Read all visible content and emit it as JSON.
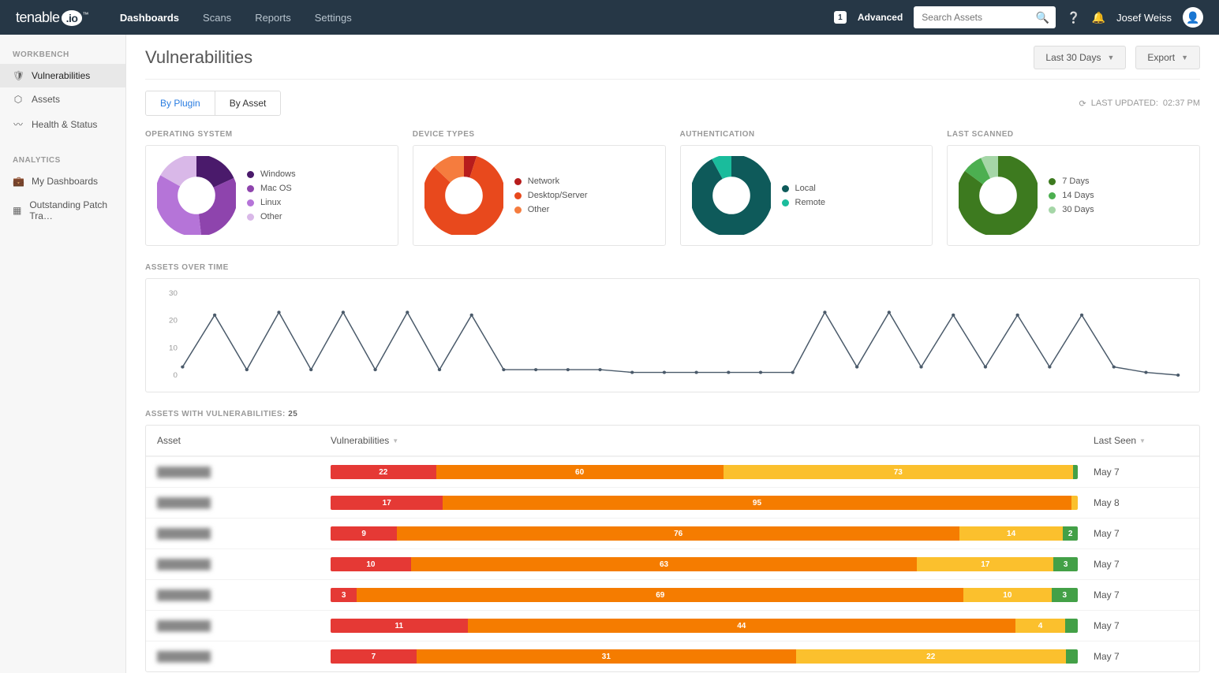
{
  "topbar": {
    "logo": "tenable",
    "logo_suffix": ".io",
    "nav": [
      "Dashboards",
      "Scans",
      "Reports",
      "Settings"
    ],
    "nav_active_index": 0,
    "advanced_badge": "1",
    "advanced_label": "Advanced",
    "search_placeholder": "Search Assets",
    "user_name": "Josef Weiss"
  },
  "sidebar": {
    "workbench_label": "WORKBENCH",
    "workbench_items": [
      {
        "icon": "shield",
        "label": "Vulnerabilities",
        "active": true
      },
      {
        "icon": "cube",
        "label": "Assets"
      },
      {
        "icon": "pulse",
        "label": "Health & Status"
      }
    ],
    "analytics_label": "ANALYTICS",
    "analytics_items": [
      {
        "icon": "briefcase",
        "label": "My Dashboards"
      },
      {
        "icon": "grid",
        "label": "Outstanding Patch Tra…"
      }
    ]
  },
  "page": {
    "title": "Vulnerabilities",
    "date_filter": "Last 30 Days",
    "export_label": "Export",
    "tabs": [
      "By Plugin",
      "By Asset"
    ],
    "tab_active_index": 1,
    "last_updated_label": "LAST UPDATED:",
    "last_updated_time": "02:37 PM"
  },
  "chart_data": [
    {
      "type": "pie",
      "title": "OPERATING SYSTEM",
      "series": [
        {
          "name": "Windows",
          "value": 18,
          "color": "#4a1a6b"
        },
        {
          "name": "Mac OS",
          "value": 30,
          "color": "#8e44ad"
        },
        {
          "name": "Linux",
          "value": 35,
          "color": "#b574d8"
        },
        {
          "name": "Other",
          "value": 17,
          "color": "#d9b8e8"
        }
      ]
    },
    {
      "type": "pie",
      "title": "DEVICE TYPES",
      "series": [
        {
          "name": "Network",
          "value": 5,
          "color": "#b71c1c"
        },
        {
          "name": "Desktop/Server",
          "value": 82,
          "color": "#e8491d"
        },
        {
          "name": "Other",
          "value": 13,
          "color": "#f57c3e"
        }
      ]
    },
    {
      "type": "pie",
      "title": "AUTHENTICATION",
      "series": [
        {
          "name": "Local",
          "value": 92,
          "color": "#0e5a5a"
        },
        {
          "name": "Remote",
          "value": 8,
          "color": "#1abc9c"
        }
      ]
    },
    {
      "type": "pie",
      "title": "LAST SCANNED",
      "series": [
        {
          "name": "7 Days",
          "value": 85,
          "color": "#3d7a1f"
        },
        {
          "name": "14 Days",
          "value": 8,
          "color": "#4caf50"
        },
        {
          "name": "30 Days",
          "value": 7,
          "color": "#a5d6a7"
        }
      ]
    },
    {
      "type": "line",
      "title": "ASSETS OVER TIME",
      "ylim": [
        0,
        30
      ],
      "yticks": [
        0,
        10,
        20,
        30
      ],
      "values": [
        3,
        22,
        2,
        23,
        2,
        23,
        2,
        23,
        2,
        22,
        2,
        2,
        2,
        2,
        1,
        1,
        1,
        1,
        1,
        1,
        23,
        3,
        23,
        3,
        22,
        3,
        22,
        3,
        22,
        3,
        1,
        0
      ]
    }
  ],
  "assets_table": {
    "title_prefix": "ASSETS WITH VULNERABILITIES:",
    "count": "25",
    "columns": {
      "asset": "Asset",
      "vuln": "Vulnerabilities",
      "last": "Last Seen"
    },
    "rows": [
      {
        "asset": "████████",
        "bars": [
          {
            "sev": "crit",
            "n": 22
          },
          {
            "sev": "high",
            "n": 60
          },
          {
            "sev": "med",
            "n": 73
          },
          {
            "sev": "low",
            "n": 1
          }
        ],
        "last": "May 7"
      },
      {
        "asset": "████████",
        "bars": [
          {
            "sev": "crit",
            "n": 17
          },
          {
            "sev": "high",
            "n": 95
          },
          {
            "sev": "med",
            "n": 1
          }
        ],
        "last": "May 8"
      },
      {
        "asset": "████████",
        "bars": [
          {
            "sev": "crit",
            "n": 9
          },
          {
            "sev": "high",
            "n": 76
          },
          {
            "sev": "med",
            "n": 14
          },
          {
            "sev": "low",
            "n": 2
          }
        ],
        "last": "May 7"
      },
      {
        "asset": "████████",
        "bars": [
          {
            "sev": "crit",
            "n": 10
          },
          {
            "sev": "high",
            "n": 63
          },
          {
            "sev": "med",
            "n": 17
          },
          {
            "sev": "low",
            "n": 3
          }
        ],
        "last": "May 7"
      },
      {
        "asset": "████████",
        "bars": [
          {
            "sev": "crit",
            "n": 3
          },
          {
            "sev": "high",
            "n": 69
          },
          {
            "sev": "med",
            "n": 10
          },
          {
            "sev": "low",
            "n": 3
          }
        ],
        "last": "May 7"
      },
      {
        "asset": "████████",
        "bars": [
          {
            "sev": "crit",
            "n": 11
          },
          {
            "sev": "high",
            "n": 44
          },
          {
            "sev": "med",
            "n": 4
          },
          {
            "sev": "low",
            "n": 1
          }
        ],
        "last": "May 7"
      },
      {
        "asset": "████████",
        "bars": [
          {
            "sev": "crit",
            "n": 7
          },
          {
            "sev": "high",
            "n": 31
          },
          {
            "sev": "med",
            "n": 22
          },
          {
            "sev": "low",
            "n": 1
          }
        ],
        "last": "May 7"
      }
    ]
  }
}
